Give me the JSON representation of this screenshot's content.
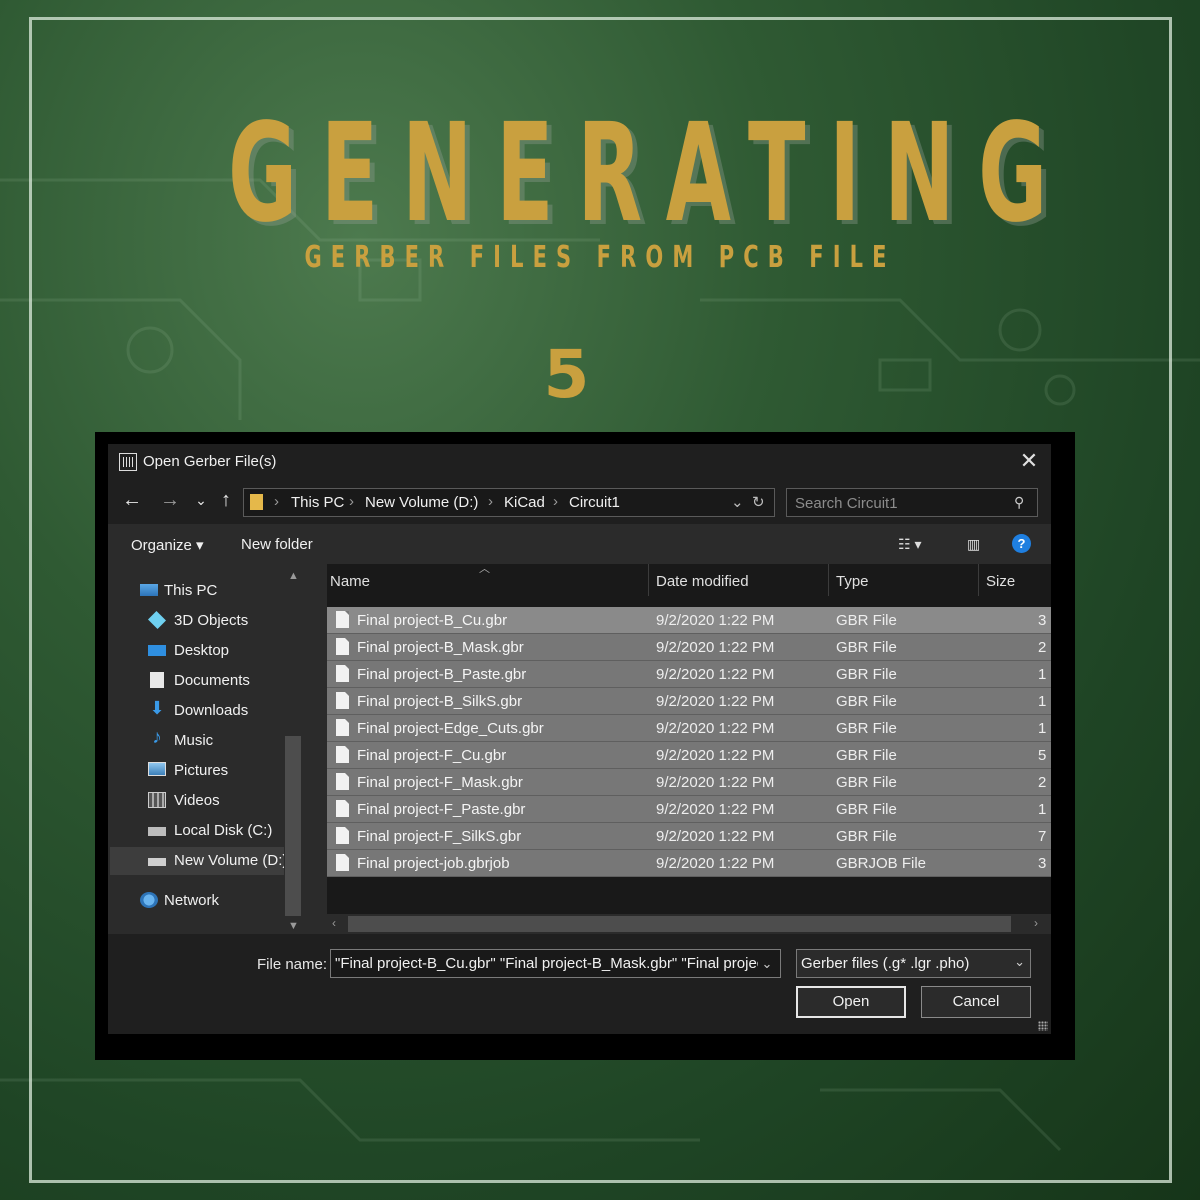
{
  "poster": {
    "title": "GENERATING",
    "subtitle": "GERBER FILES FROM PCB FILE",
    "step": "5"
  },
  "colors": {
    "gold": "#c9a03f",
    "background_green": "#2f5a33",
    "selection_row": "#777777",
    "help_blue": "#1f7fe0"
  },
  "dialog": {
    "title": "Open Gerber File(s)",
    "close_icon": "close-icon",
    "nav": {
      "back": "←",
      "forward": "→",
      "recent": "⌄",
      "up": "↑"
    },
    "breadcrumb": [
      "This PC",
      "New Volume (D:)",
      "KiCad",
      "Circuit1"
    ],
    "search_placeholder": "Search Circuit1",
    "toolbar": {
      "organize": "Organize ▾",
      "new_folder": "New folder"
    },
    "sidebar": [
      {
        "label": "This PC",
        "icon": "computer-icon"
      },
      {
        "label": "3D Objects",
        "icon": "cube-icon"
      },
      {
        "label": "Desktop",
        "icon": "desktop-icon"
      },
      {
        "label": "Documents",
        "icon": "document-icon"
      },
      {
        "label": "Downloads",
        "icon": "download-icon"
      },
      {
        "label": "Music",
        "icon": "music-icon"
      },
      {
        "label": "Pictures",
        "icon": "picture-icon"
      },
      {
        "label": "Videos",
        "icon": "video-icon"
      },
      {
        "label": "Local Disk (C:)",
        "icon": "drive-icon"
      },
      {
        "label": "New Volume (D:)",
        "icon": "drive-icon"
      },
      {
        "label": "Network",
        "icon": "network-icon"
      }
    ],
    "columns": [
      "Name",
      "Date modified",
      "Type",
      "Size"
    ],
    "files": [
      {
        "name": "Final project-B_Cu.gbr",
        "date": "9/2/2020 1:22 PM",
        "type": "GBR File",
        "size": "3"
      },
      {
        "name": "Final project-B_Mask.gbr",
        "date": "9/2/2020 1:22 PM",
        "type": "GBR File",
        "size": "2"
      },
      {
        "name": "Final project-B_Paste.gbr",
        "date": "9/2/2020 1:22 PM",
        "type": "GBR File",
        "size": "1"
      },
      {
        "name": "Final project-B_SilkS.gbr",
        "date": "9/2/2020 1:22 PM",
        "type": "GBR File",
        "size": "1"
      },
      {
        "name": "Final project-Edge_Cuts.gbr",
        "date": "9/2/2020 1:22 PM",
        "type": "GBR File",
        "size": "1"
      },
      {
        "name": "Final project-F_Cu.gbr",
        "date": "9/2/2020 1:22 PM",
        "type": "GBR File",
        "size": "5"
      },
      {
        "name": "Final project-F_Mask.gbr",
        "date": "9/2/2020 1:22 PM",
        "type": "GBR File",
        "size": "2"
      },
      {
        "name": "Final project-F_Paste.gbr",
        "date": "9/2/2020 1:22 PM",
        "type": "GBR File",
        "size": "1"
      },
      {
        "name": "Final project-F_SilkS.gbr",
        "date": "9/2/2020 1:22 PM",
        "type": "GBR File",
        "size": "7"
      },
      {
        "name": "Final project-job.gbrjob",
        "date": "9/2/2020 1:22 PM",
        "type": "GBRJOB File",
        "size": "3"
      }
    ],
    "file_name_label": "File name:",
    "file_name_value": "\"Final project-B_Cu.gbr\" \"Final project-B_Mask.gbr\" \"Final projec",
    "filter_value": "Gerber files (.g* .lgr .pho)",
    "open_label": "Open",
    "cancel_label": "Cancel"
  }
}
